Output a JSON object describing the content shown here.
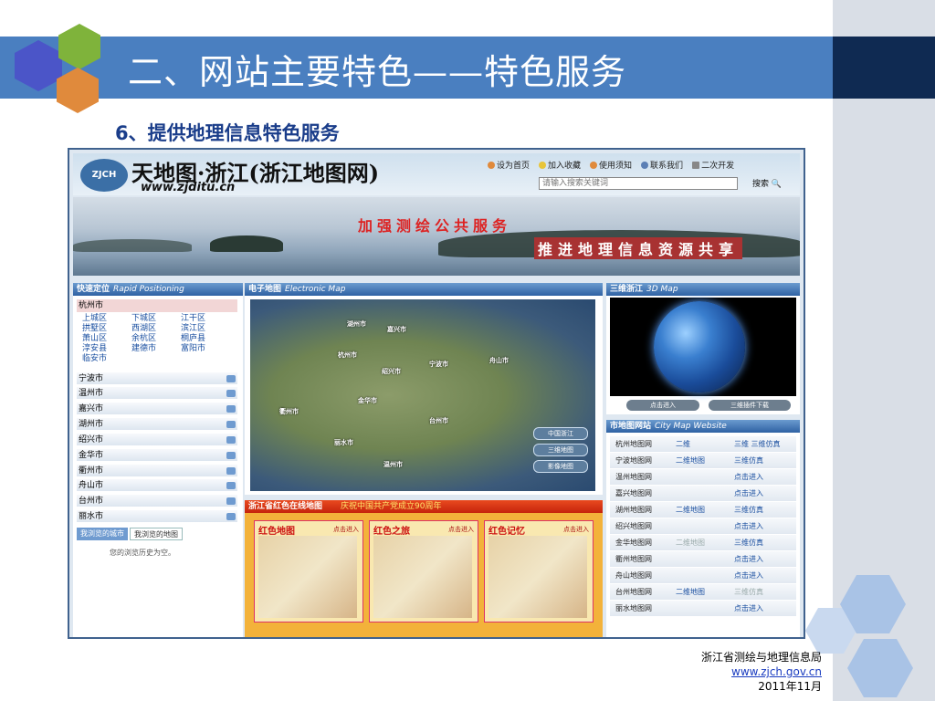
{
  "slide": {
    "title": "二、网站主要特色——特色服务",
    "subtitle": "6、提供地理信息特色服务",
    "footer": {
      "org": "浙江省测绘与地理信息局",
      "url": "www.zjch.gov.cn",
      "date": "2011年11月"
    }
  },
  "site": {
    "logo_badge": "ZJCH",
    "logo_title": "天地图·浙江(浙江地图网)",
    "logo_url": "www.zjditu.cn",
    "topnav": [
      "设为首页",
      "加入收藏",
      "使用须知",
      "联系我们",
      "二次开发"
    ],
    "search_placeholder": "请输入搜索关键词",
    "search_label": "搜索",
    "slogan1": "加强测绘公共服务",
    "slogan2": "推进地理信息资源共享",
    "quick_locate": {
      "title": "快速定位",
      "title_en": "Rapid Positioning"
    },
    "current_city": "杭州市",
    "districts": [
      "上城区",
      "下城区",
      "江干区",
      "拱墅区",
      "西湖区",
      "滨江区",
      "萧山区",
      "余杭区",
      "桐庐县",
      "淳安县",
      "建德市",
      "富阳市",
      "临安市"
    ],
    "cities": [
      "宁波市",
      "温州市",
      "嘉兴市",
      "湖州市",
      "绍兴市",
      "金华市",
      "衢州市",
      "舟山市",
      "台州市",
      "丽水市"
    ],
    "history_tabs": [
      "我浏览的城市",
      "我浏览的地图"
    ],
    "history_empty": "您的浏览历史为空。",
    "emap": {
      "title": "电子地图",
      "title_en": "Electronic Map",
      "labels": [
        "湖州市",
        "嘉兴市",
        "杭州市",
        "绍兴市",
        "宁波市",
        "舟山市",
        "金华市",
        "台州市",
        "衢州市",
        "丽水市",
        "温州市"
      ],
      "buttons": [
        "中国浙江",
        "三维地图",
        "影像地图"
      ]
    },
    "redmap": {
      "title": "浙江省红色在线地图",
      "banner": "庆祝中国共产党成立90周年",
      "cards": [
        {
          "title": "红色地图",
          "enter": "点击进入"
        },
        {
          "title": "红色之旅",
          "enter": "点击进入"
        },
        {
          "title": "红色记忆",
          "enter": "点击进入"
        }
      ]
    },
    "map3d": {
      "title": "三维浙江",
      "title_en": "3D Map",
      "btn_enter": "点击进入",
      "btn_plugin": "三维插件下载"
    },
    "citysites": {
      "title": "市地图网站",
      "title_en": "City Map Website",
      "rows": [
        {
          "name": "杭州地图网",
          "c2": "二维",
          "c3": "三维  三维仿真"
        },
        {
          "name": "宁波地图网",
          "c2": "二维地图",
          "c3": "三维仿真"
        },
        {
          "name": "温州地图网",
          "c2": "",
          "c3": "点击进入"
        },
        {
          "name": "嘉兴地图网",
          "c2": "",
          "c3": "点击进入"
        },
        {
          "name": "湖州地图网",
          "c2": "二维地图",
          "c3": "三维仿真"
        },
        {
          "name": "绍兴地图网",
          "c2": "",
          "c3": "点击进入"
        },
        {
          "name": "金华地图网",
          "c2": "二维地图",
          "c3": "三维仿真"
        },
        {
          "name": "衢州地图网",
          "c2": "",
          "c3": "点击进入"
        },
        {
          "name": "舟山地图网",
          "c2": "",
          "c3": "点击进入"
        },
        {
          "name": "台州地图网",
          "c2": "二维地图",
          "c3": "三维仿真"
        },
        {
          "name": "丽水地图网",
          "c2": "",
          "c3": "点击进入"
        }
      ]
    }
  }
}
